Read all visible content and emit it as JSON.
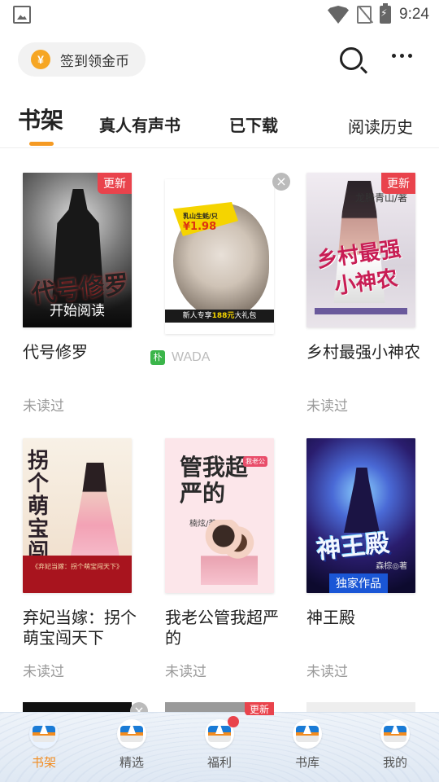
{
  "status_bar": {
    "time": "9:24"
  },
  "header": {
    "sign_in_label": "签到领金币",
    "coin_symbol": "¥"
  },
  "tabs": [
    {
      "label": "书架"
    },
    {
      "label": "真人有声书"
    },
    {
      "label": "已下载"
    },
    {
      "label": "阅读历史"
    }
  ],
  "books": [
    {
      "title": "代号修罗",
      "status": "未读过",
      "badge": "更新",
      "overlay": "开始阅读",
      "cover_text": "代号修罗"
    },
    {
      "title": "",
      "status": "",
      "ad_label": "WADA",
      "ad_logo": "朴",
      "cover_price": "¥1.98",
      "cover_price_top": "乳山生蚝/只",
      "cover_strip_a": "新人专享",
      "cover_strip_b": "188元",
      "cover_strip_c": "大礼包"
    },
    {
      "title": "乡村最强小神农",
      "status": "未读过",
      "badge": "更新",
      "cover_author": "龙腾青山/著",
      "cover_text_a": "乡村最强",
      "cover_text_b": "小神农"
    },
    {
      "title": "弃妃当嫁：拐个萌宝闯天下",
      "status": "未读过",
      "cover_text": "拐个萌宝闯天下",
      "cover_sub": "《弃妃当嫁：拐个萌宝闯天下》"
    },
    {
      "title": "我老公管我超严的",
      "status": "未读过",
      "cover_text": "管我超严的",
      "cover_tag": "我老公",
      "cover_author": "楠炫/著"
    },
    {
      "title": "神王殿",
      "status": "未读过",
      "exclusive": "独家作品",
      "cover_text": "神王殿",
      "cover_author": "森棕◎著"
    }
  ],
  "peek_badge": "更新",
  "bottom_nav": [
    {
      "label": "书架",
      "active": true
    },
    {
      "label": "精选",
      "active": false
    },
    {
      "label": "福利",
      "active": false,
      "dot": true
    },
    {
      "label": "书库",
      "active": false
    },
    {
      "label": "我的",
      "active": false
    }
  ],
  "colors": {
    "accent": "#f59a23",
    "badge_red": "#e9434c",
    "muted_text": "#999999",
    "exclusive_blue": "#1a56d6"
  }
}
